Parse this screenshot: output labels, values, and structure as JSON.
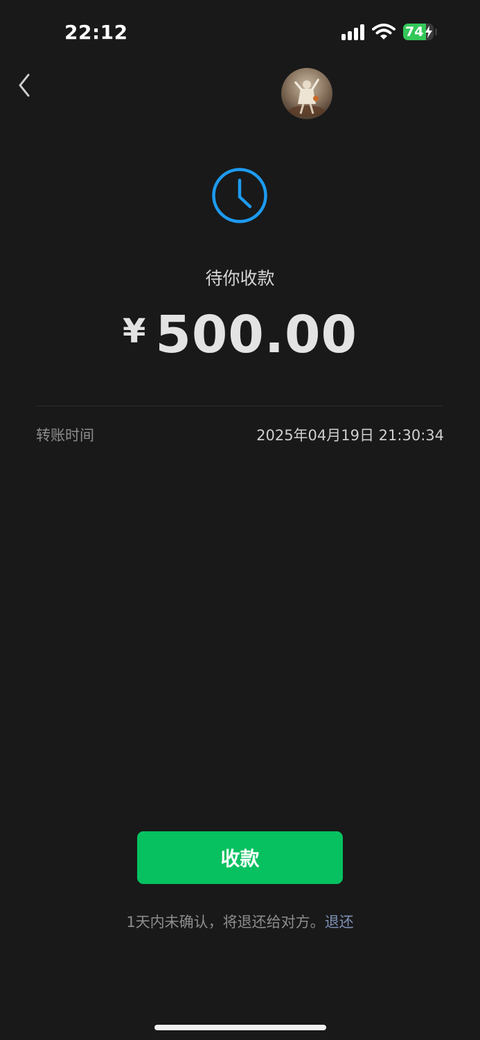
{
  "status_bar": {
    "time": "22:12",
    "battery_level": "74",
    "battery_fraction": 0.74,
    "signal_icon": "cellular-signal-icon",
    "wifi_icon": "wifi-icon",
    "charging_icon": "bolt-icon"
  },
  "nav": {
    "back_icon": "chevron-left-icon",
    "avatar": "user-avatar"
  },
  "transfer": {
    "status_icon": "clock-icon",
    "status_text": "待你收款",
    "currency": "¥",
    "amount": "500.00",
    "time_label": "转账时间",
    "time_value": "2025年04月19日 21:30:34"
  },
  "actions": {
    "receive_label": "收款",
    "notice_text": "1天内未确认，将退还给对方。",
    "return_link": "退还"
  },
  "colors": {
    "background": "#191919",
    "accent_green": "#07c160",
    "clock_blue": "#1d9bf0",
    "link_blue": "#7d90b7"
  }
}
